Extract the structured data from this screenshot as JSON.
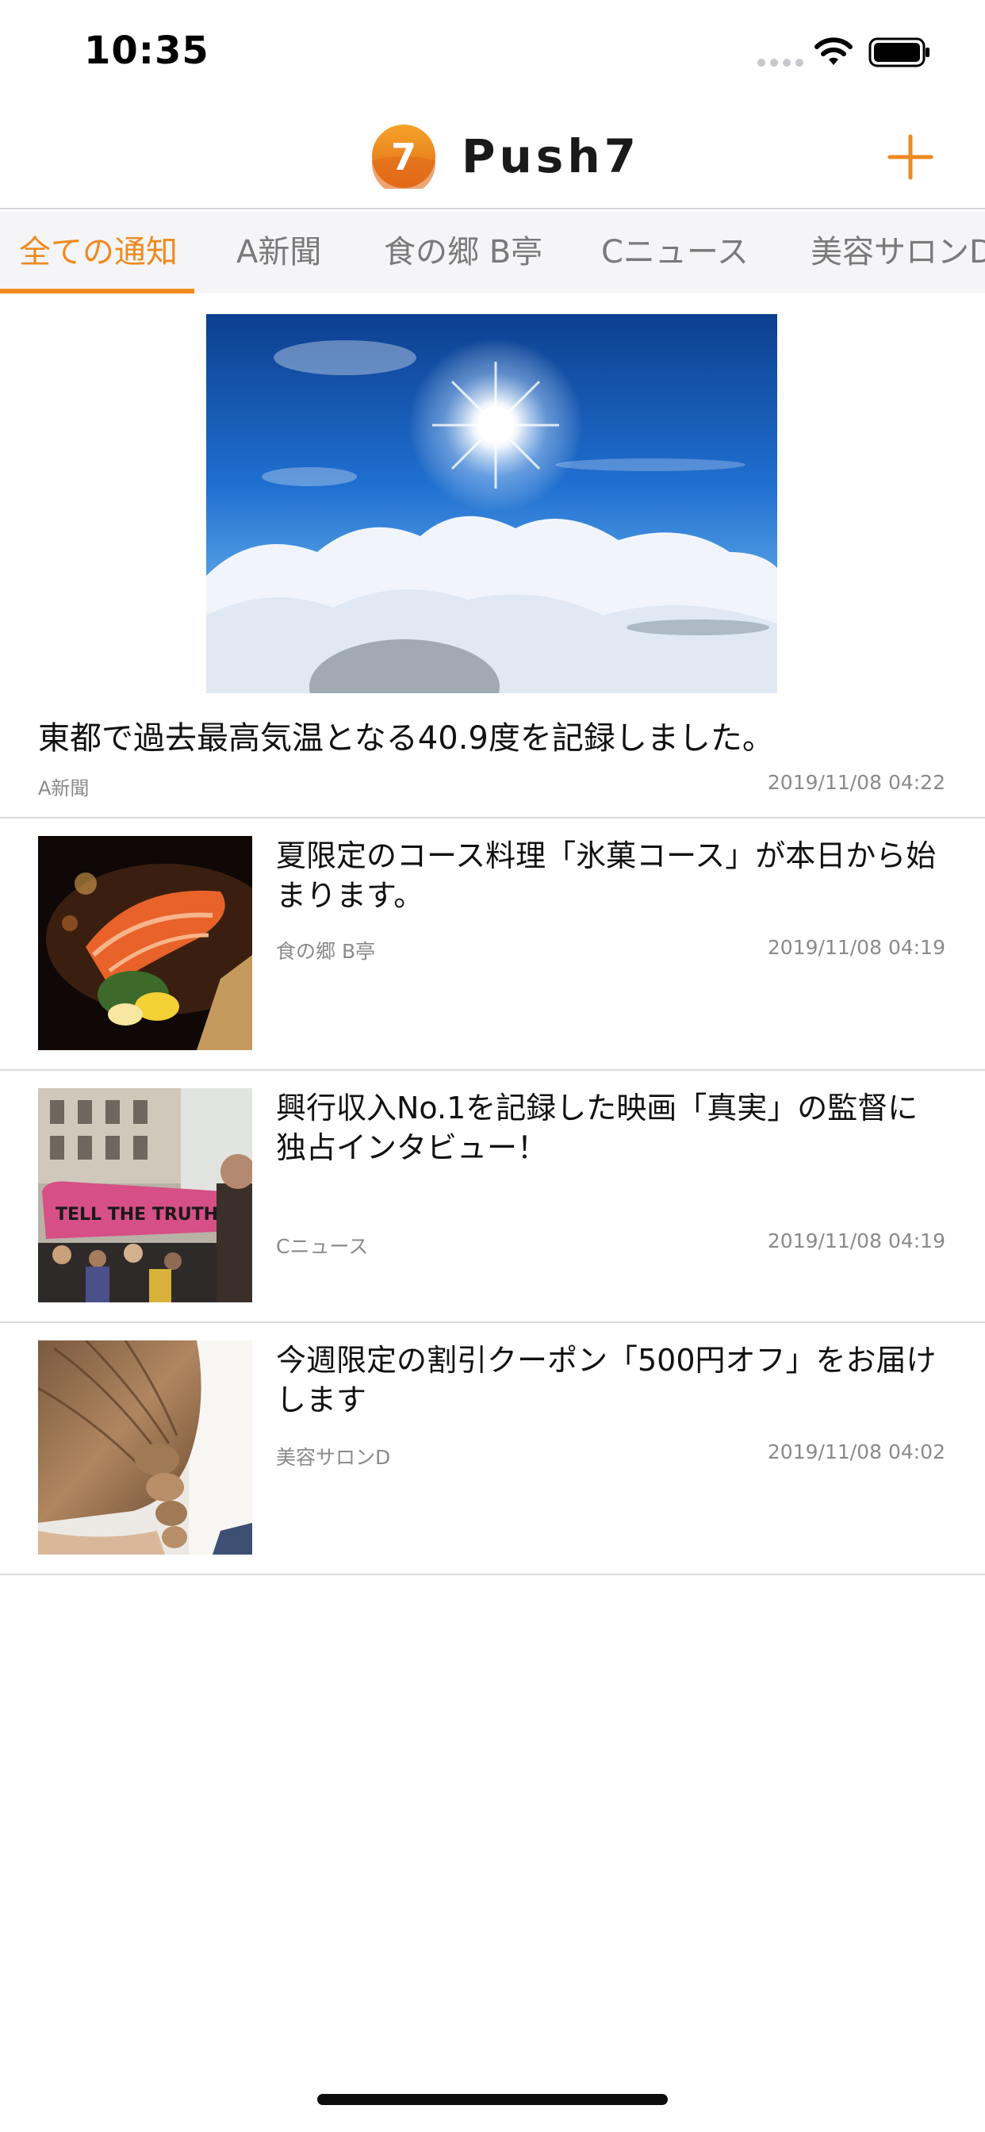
{
  "status_bar": {
    "time": "10:35",
    "icons": [
      "signal-dots-icon",
      "wifi-icon",
      "battery-icon"
    ]
  },
  "header": {
    "logo_icon": "push7-logo-icon",
    "logo_glyph": "7",
    "title": "Push7",
    "add_icon": "plus-icon",
    "accent_color": "#ee8a1f"
  },
  "tabs": [
    {
      "label": "全ての通知",
      "active": true
    },
    {
      "label": "A新聞",
      "active": false
    },
    {
      "label": "食の郷 B亭",
      "active": false
    },
    {
      "label": "Cニュース",
      "active": false
    },
    {
      "label": "美容サロンD",
      "active": false
    }
  ],
  "feature": {
    "image": "sun-above-clouds-photo",
    "title": "東都で過去最高気温となる40.9度を記録しました。",
    "source": "A新聞",
    "date": "2019/11/08 04:22"
  },
  "items": [
    {
      "image": "salmon-dish-photo",
      "title": "夏限定のコース料理「氷菓コース」が本日から始まります。",
      "source": "食の郷 B亭",
      "date": "2019/11/08 04:19"
    },
    {
      "image": "protest-bus-photo",
      "title": "興行収入No.1を記録した映画「真実」の監督に独占インタビュー！",
      "source": "Cニュース",
      "date": "2019/11/08 04:19",
      "photo_text": "TELL THE TRUTH"
    },
    {
      "image": "braided-hair-photo",
      "title": "今週限定の割引クーポン「500円オフ」をお届けします",
      "source": "美容サロンD",
      "date": "2019/11/08 04:02"
    }
  ]
}
